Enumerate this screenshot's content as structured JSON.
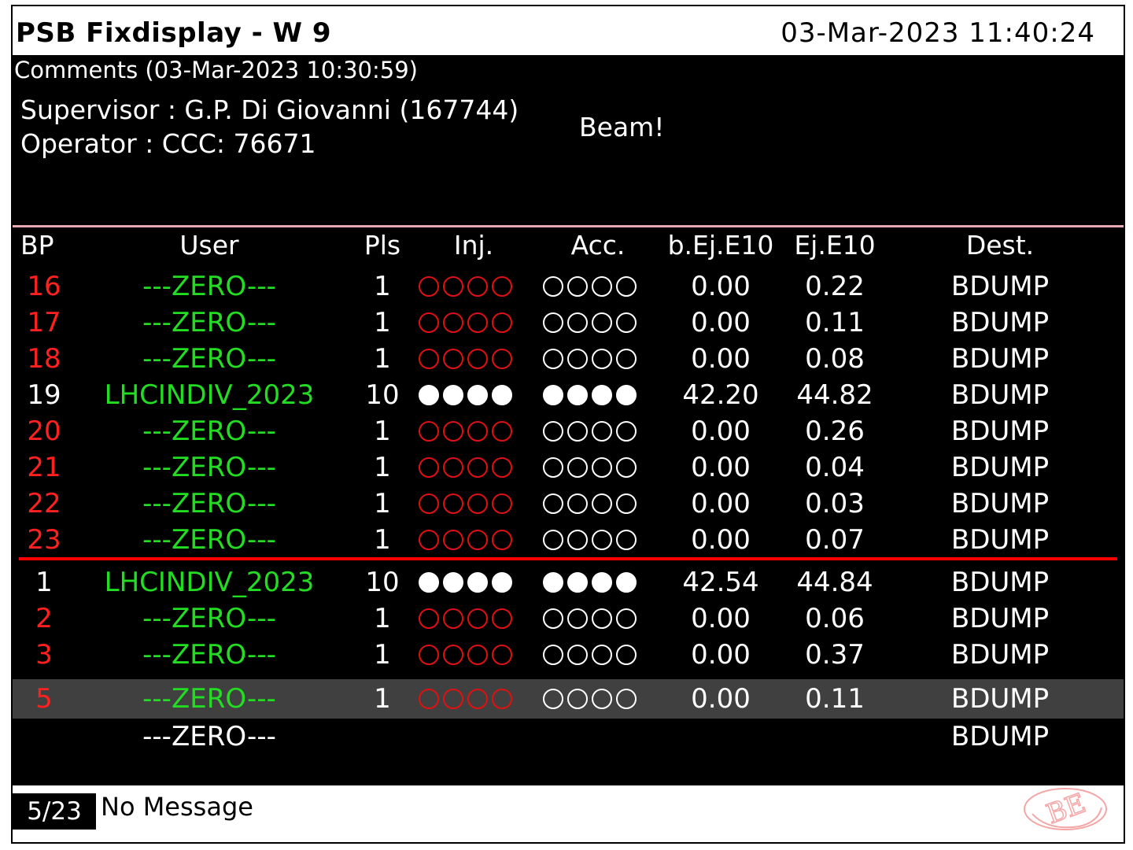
{
  "window": {
    "title": "PSB Fixdisplay - W 9",
    "datetime": "03-Mar-2023 11:40:24"
  },
  "comments": {
    "header": "Comments (03-Mar-2023 10:30:59)",
    "supervisor": "Supervisor : G.P. Di Giovanni (167744)",
    "operator": "Operator : CCC: 76671",
    "message": "Beam!"
  },
  "table": {
    "headers": {
      "bp": "BP",
      "user": "User",
      "pls": "Pls",
      "inj": "Inj.",
      "acc": "Acc.",
      "bej": "b.Ej.E10",
      "ej": "Ej.E10",
      "dest": "Dest."
    },
    "rows": [
      {
        "bp": "16",
        "user": "---ZERO---",
        "pls": "1",
        "bej": "0.00",
        "ej": "0.22",
        "dest": "BDUMP"
      },
      {
        "bp": "17",
        "user": "---ZERO---",
        "pls": "1",
        "bej": "0.00",
        "ej": "0.11",
        "dest": "BDUMP"
      },
      {
        "bp": "18",
        "user": "---ZERO---",
        "pls": "1",
        "bej": "0.00",
        "ej": "0.08",
        "dest": "BDUMP"
      },
      {
        "bp": "19",
        "user": "LHCINDIV_2023",
        "pls": "10",
        "bej": "42.20",
        "ej": "44.82",
        "dest": "BDUMP"
      },
      {
        "bp": "20",
        "user": "---ZERO---",
        "pls": "1",
        "bej": "0.00",
        "ej": "0.26",
        "dest": "BDUMP"
      },
      {
        "bp": "21",
        "user": "---ZERO---",
        "pls": "1",
        "bej": "0.00",
        "ej": "0.04",
        "dest": "BDUMP"
      },
      {
        "bp": "22",
        "user": "---ZERO---",
        "pls": "1",
        "bej": "0.00",
        "ej": "0.03",
        "dest": "BDUMP"
      },
      {
        "bp": "23",
        "user": "---ZERO---",
        "pls": "1",
        "bej": "0.00",
        "ej": "0.07",
        "dest": "BDUMP"
      },
      {
        "bp": "1",
        "user": "LHCINDIV_2023",
        "pls": "10",
        "bej": "42.54",
        "ej": "44.84",
        "dest": "BDUMP"
      },
      {
        "bp": "2",
        "user": "---ZERO---",
        "pls": "1",
        "bej": "0.00",
        "ej": "0.06",
        "dest": "BDUMP"
      },
      {
        "bp": "3",
        "user": "---ZERO---",
        "pls": "1",
        "bej": "0.00",
        "ej": "0.37",
        "dest": "BDUMP"
      },
      {
        "bp": "5",
        "user": "---ZERO---",
        "pls": "1",
        "bej": "0.00",
        "ej": "0.11",
        "dest": "BDUMP"
      },
      {
        "bp": "",
        "user": "---ZERO---",
        "pls": "",
        "bej": "",
        "ej": "",
        "dest": "BDUMP"
      }
    ]
  },
  "footer": {
    "counter": "5/23",
    "message": "No Message"
  },
  "logo": {
    "text": "BE"
  },
  "colors": {
    "background": "#000000",
    "user_green": "#22dd22",
    "bp_red": "#ff2020",
    "separator_red": "#ff0000",
    "selected_row": "#404040"
  }
}
